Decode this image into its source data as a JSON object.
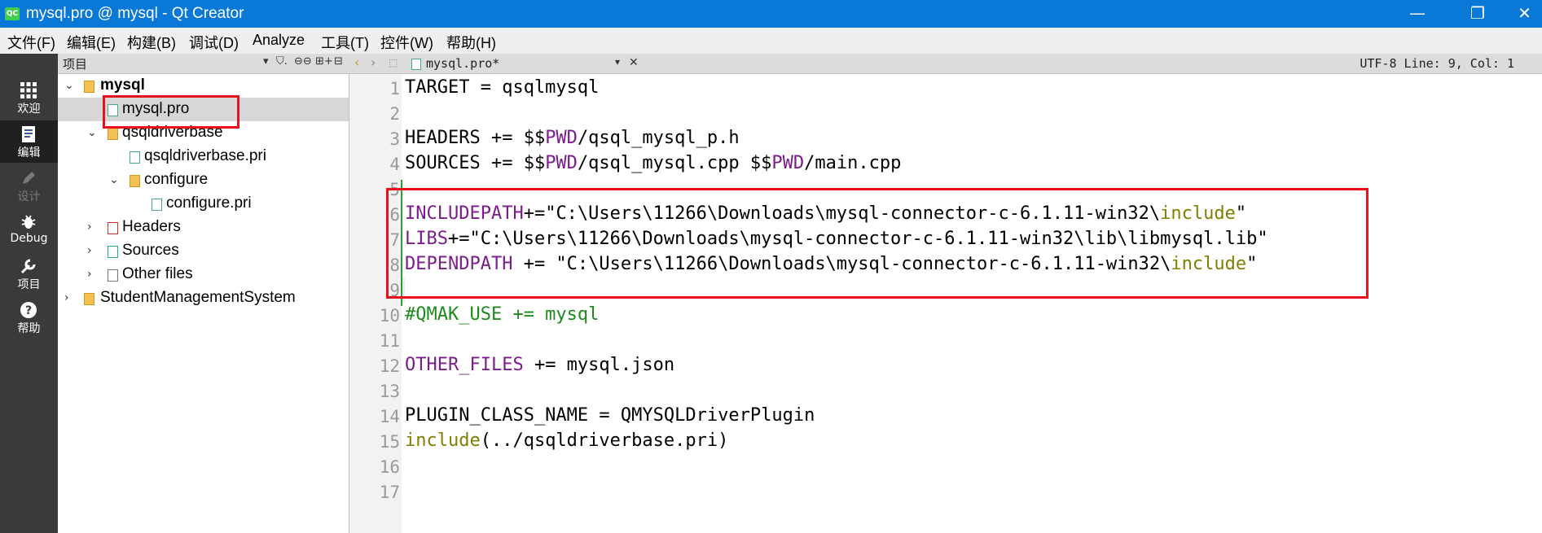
{
  "window": {
    "title": "mysql.pro @ mysql - Qt Creator",
    "logo": "QC",
    "controls": [
      "—",
      "❐",
      "✕"
    ]
  },
  "menu": [
    "文件(F)",
    "编辑(E)",
    "构建(B)",
    "调试(D)",
    "Analyze",
    "工具(T)",
    "控件(W)",
    "帮助(H)"
  ],
  "modes": [
    {
      "label": "欢迎",
      "icon": "grid-icon"
    },
    {
      "label": "编辑",
      "icon": "edit-doc-icon"
    },
    {
      "label": "设计",
      "icon": "pencil-icon"
    },
    {
      "label": "Debug",
      "icon": "bug-icon"
    },
    {
      "label": "项目",
      "icon": "wrench-icon"
    },
    {
      "label": "帮助",
      "icon": "help-icon"
    }
  ],
  "project_panel": {
    "title": "项目",
    "toolbar_glyphs": [
      "▾",
      "⛉.",
      "⊖⊖",
      "⊞+",
      "⊟"
    ]
  },
  "tree": [
    {
      "label": "mysql",
      "arrow": "⌄",
      "icon": "project-folder-icon"
    },
    {
      "label": "mysql.pro",
      "arrow": "",
      "icon": "pro-file-icon"
    },
    {
      "label": "qsqldriverbase",
      "arrow": "⌄",
      "icon": "project-folder-icon"
    },
    {
      "label": "qsqldriverbase.pri",
      "arrow": "",
      "icon": "pri-file-icon"
    },
    {
      "label": "configure",
      "arrow": "⌄",
      "icon": "project-folder-icon"
    },
    {
      "label": "configure.pri",
      "arrow": "",
      "icon": "pri-file-icon"
    },
    {
      "label": "Headers",
      "arrow": "›",
      "icon": "headers-folder-icon"
    },
    {
      "label": "Sources",
      "arrow": "›",
      "icon": "sources-folder-icon"
    },
    {
      "label": "Other files",
      "arrow": "›",
      "icon": "other-files-folder-icon"
    },
    {
      "label": "StudentManagementSystem",
      "arrow": "›",
      "icon": "project-folder-icon"
    }
  ],
  "editor": {
    "nav_back": "‹",
    "nav_forward": "›",
    "lock": "⬚",
    "file_tab": "mysql.pro*",
    "tab_dropdown": "▾",
    "tab_close": "✕",
    "status": "UTF-8 Line: 9, Col: 1",
    "line_numbers": [
      "1",
      "2",
      "3",
      "4",
      "5",
      "6",
      "7",
      "8",
      "9",
      "10",
      "11",
      "12",
      "13",
      "14",
      "15",
      "16",
      "17"
    ],
    "code": {
      "l1": "TARGET = qsqlmysql",
      "l3a": "HEADERS += $$",
      "l3b": "PWD",
      "l3c": "/qsql_mysql_p.h",
      "l4a": "SOURCES += $$",
      "l4b": "PWD",
      "l4c": "/qsql_mysql.cpp $$",
      "l4d": "PWD",
      "l4e": "/main.cpp",
      "l6a": "INCLUDEPATH",
      "l6b": "+=\"C:\\Users\\11266\\Downloads\\mysql-connector-c-6.1.11-win32\\",
      "l6c": "include",
      "l6d": "\"",
      "l7a": "LIBS",
      "l7b": "+=\"C:\\Users\\11266\\Downloads\\mysql-connector-c-6.1.11-win32\\lib\\libmysql.lib\"",
      "l8a": "DEPENDPATH",
      "l8b": " += \"C:\\Users\\11266\\Downloads\\mysql-connector-c-6.1.11-win32\\",
      "l8c": "include",
      "l8d": "\"",
      "l10": "#QMAK_USE += mysql",
      "l12a": "OTHER_FILES",
      "l12b": " += mysql.json",
      "l14": "PLUGIN_CLASS_NAME = QMYSQLDriverPlugin",
      "l15a": "include",
      "l15b": "(../qsqldriverbase.pri)"
    }
  },
  "colors": {
    "titlebar": "#0a78d7",
    "highlight_box": "#e8101a",
    "qmake_variable": "#7a1c8b",
    "keyword": "#7f7f00",
    "comment": "#1d8a1d"
  }
}
